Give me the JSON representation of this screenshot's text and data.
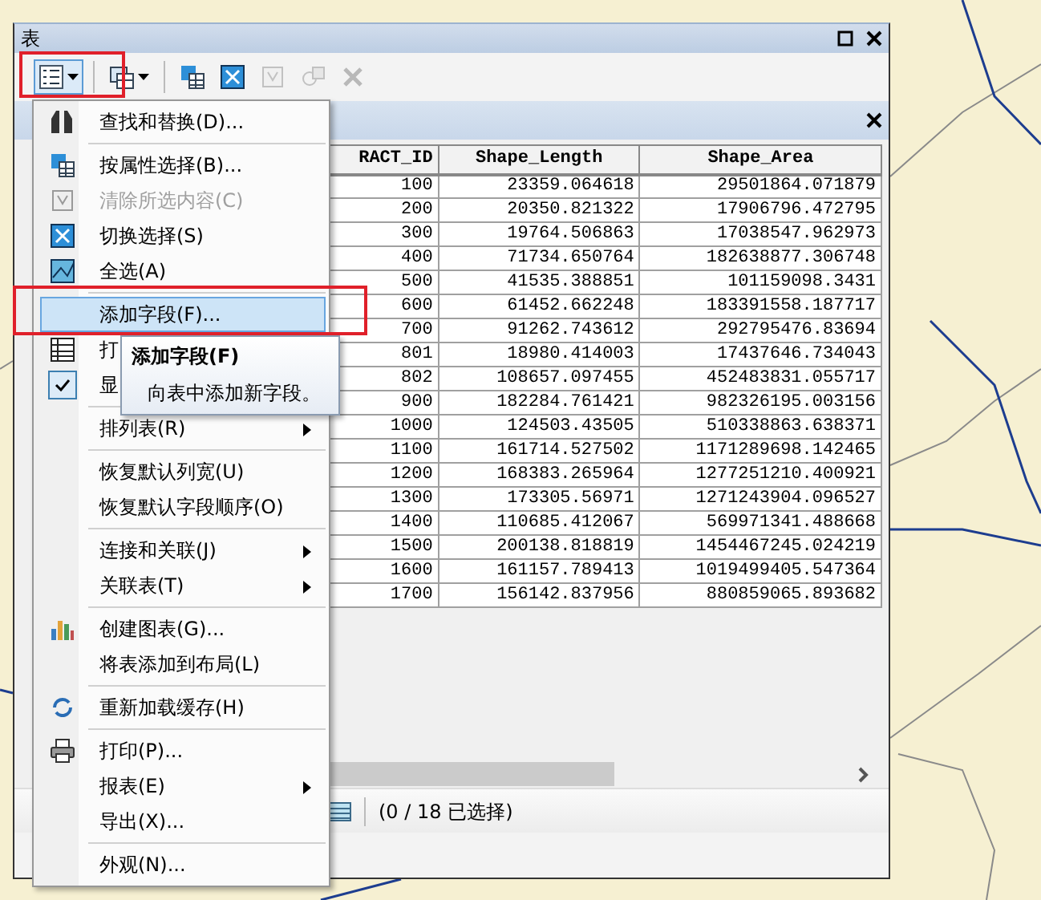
{
  "window": {
    "title": "表"
  },
  "toolbar": [
    {
      "dropdown": true,
      "disabled": false,
      "separator_before": false
    },
    {
      "dropdown": true,
      "disabled": false,
      "separator_before": true
    },
    {
      "dropdown": false,
      "disabled": false,
      "separator_before": true
    },
    {
      "dropdown": false,
      "disabled": false,
      "separator_before": false
    },
    {
      "dropdown": false,
      "disabled": true,
      "separator_before": false
    },
    {
      "dropdown": false,
      "disabled": true,
      "separator_before": false
    },
    {
      "dropdown": false,
      "disabled": true,
      "separator_before": false
    }
  ],
  "menu": [
    {
      "label": "查找和替换(D)...",
      "disabled": false,
      "selected": false,
      "checked": false,
      "submenu": false,
      "separator_before": false
    },
    {
      "label": "按属性选择(B)...",
      "disabled": false,
      "selected": false,
      "checked": false,
      "submenu": false,
      "separator_before": true
    },
    {
      "label": "清除所选内容(C)",
      "disabled": true,
      "selected": false,
      "checked": false,
      "submenu": false,
      "separator_before": false
    },
    {
      "label": "切换选择(S)",
      "disabled": false,
      "selected": false,
      "checked": false,
      "submenu": false,
      "separator_before": false
    },
    {
      "label": "全选(A)",
      "disabled": false,
      "selected": false,
      "checked": false,
      "submenu": false,
      "separator_before": false
    },
    {
      "label": "添加字段(F)...",
      "disabled": false,
      "selected": true,
      "checked": false,
      "submenu": false,
      "separator_before": true
    },
    {
      "label": "打",
      "disabled": false,
      "selected": false,
      "checked": false,
      "submenu": false,
      "separator_before": false
    },
    {
      "label": "显",
      "disabled": false,
      "selected": false,
      "checked": true,
      "submenu": false,
      "separator_before": false
    },
    {
      "label": "排列表(R)",
      "disabled": false,
      "selected": false,
      "checked": false,
      "submenu": true,
      "separator_before": true
    },
    {
      "label": "恢复默认列宽(U)",
      "disabled": false,
      "selected": false,
      "checked": false,
      "submenu": false,
      "separator_before": true
    },
    {
      "label": "恢复默认字段顺序(O)",
      "disabled": false,
      "selected": false,
      "checked": false,
      "submenu": false,
      "separator_before": false
    },
    {
      "label": "连接和关联(J)",
      "disabled": false,
      "selected": false,
      "checked": false,
      "submenu": true,
      "separator_before": true
    },
    {
      "label": "关联表(T)",
      "disabled": false,
      "selected": false,
      "checked": false,
      "submenu": true,
      "separator_before": false
    },
    {
      "label": "创建图表(G)...",
      "disabled": false,
      "selected": false,
      "checked": false,
      "submenu": false,
      "separator_before": true
    },
    {
      "label": "将表添加到布局(L)",
      "disabled": false,
      "selected": false,
      "checked": false,
      "submenu": false,
      "separator_before": false
    },
    {
      "label": "重新加载缓存(H)",
      "disabled": false,
      "selected": false,
      "checked": false,
      "submenu": false,
      "separator_before": true
    },
    {
      "label": "打印(P)...",
      "disabled": false,
      "selected": false,
      "checked": false,
      "submenu": false,
      "separator_before": true
    },
    {
      "label": "报表(E)",
      "disabled": false,
      "selected": false,
      "checked": false,
      "submenu": true,
      "separator_before": false
    },
    {
      "label": "导出(X)...",
      "disabled": false,
      "selected": false,
      "checked": false,
      "submenu": false,
      "separator_before": false
    },
    {
      "label": "外观(N)...",
      "disabled": false,
      "selected": false,
      "checked": false,
      "submenu": false,
      "separator_before": true
    }
  ],
  "tooltip": {
    "title": "添加字段(F)",
    "text": "向表中添加新字段。"
  },
  "table": {
    "columns": [
      "RACT_ID",
      "Shape_Length",
      "Shape_Area"
    ],
    "rows": [
      [
        "100",
        "23359.064618",
        "29501864.071879"
      ],
      [
        "200",
        "20350.821322",
        "17906796.472795"
      ],
      [
        "300",
        "19764.506863",
        "17038547.962973"
      ],
      [
        "400",
        "71734.650764",
        "182638877.306748"
      ],
      [
        "500",
        "41535.388851",
        "101159098.3431"
      ],
      [
        "600",
        "61452.662248",
        "183391558.187717"
      ],
      [
        "700",
        "91262.743612",
        "292795476.83694"
      ],
      [
        "801",
        "18980.414003",
        "17437646.734043"
      ],
      [
        "802",
        "108657.097455",
        "452483831.055717"
      ],
      [
        "900",
        "182284.761421",
        "982326195.003156"
      ],
      [
        "1000",
        "124503.43505",
        "510338863.638371"
      ],
      [
        "1100",
        "161714.527502",
        "1171289698.142465"
      ],
      [
        "1200",
        "168383.265964",
        "1277251210.400921"
      ],
      [
        "1300",
        "173305.56971",
        "1271243904.096527"
      ],
      [
        "1400",
        "110685.412067",
        "569971341.488668"
      ],
      [
        "1500",
        "200138.818819",
        "1454467245.024219"
      ],
      [
        "1600",
        "161157.789413",
        "1019499405.547364"
      ],
      [
        "1700",
        "156142.837956",
        "880859065.893682"
      ]
    ]
  },
  "status_bar": {
    "selection": "(0 / 18 已选择)"
  }
}
